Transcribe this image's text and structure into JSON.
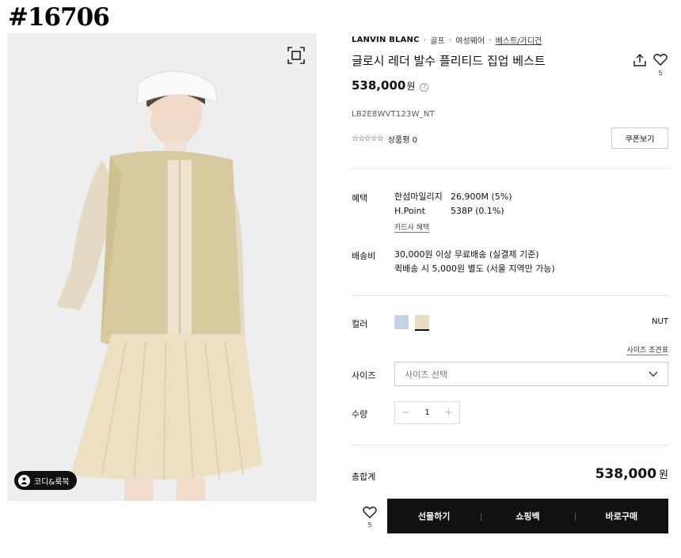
{
  "page_id": "#16706",
  "image": {
    "coordi_label": "코디&룩북"
  },
  "breadcrumb": {
    "brand": "LANVIN BLANC",
    "items": [
      "골프",
      "여성웨어",
      "베스트/가디건"
    ]
  },
  "product": {
    "title": "글로시 레더 발수 플리티드 집업 베스트",
    "price": "538,000",
    "currency": "원",
    "code": "LB2E8WVT123W_NT",
    "stars": "☆☆☆☆☆",
    "review_text": "상품평 0",
    "wish_count": "5"
  },
  "coupon_label": "쿠폰보기",
  "benefits": {
    "label": "혜택",
    "rows": [
      {
        "name": "한섬마일리지",
        "value": "26,900M (5%)"
      },
      {
        "name": "H.Point",
        "value": "538P (0.1%)"
      }
    ],
    "card_link": "카드사 혜택"
  },
  "shipping": {
    "label": "배송비",
    "line1": "30,000원 이상 무료배송 (실결제 기준)",
    "line2": "퀵배송 시 5,000원 별도 (서울 지역만 가능)"
  },
  "color": {
    "label": "컬러",
    "swatches": [
      "#c5d2e8",
      "#e8dcc0"
    ],
    "selected_name": "NUT"
  },
  "size": {
    "guide_link": "사이즈 조견표",
    "label": "사이즈",
    "placeholder": "사이즈 선택"
  },
  "quantity": {
    "label": "수량",
    "minus": "−",
    "value": "1",
    "plus": "+"
  },
  "total": {
    "label": "총합계",
    "amount": "538,000",
    "currency": "원"
  },
  "actions": {
    "wish_count": "5",
    "gift": "선물하기",
    "cart": "쇼핑백",
    "buy": "바로구매"
  }
}
